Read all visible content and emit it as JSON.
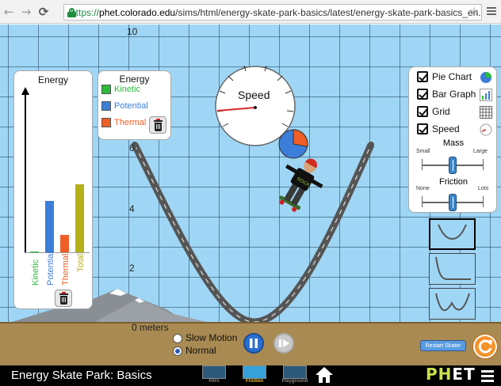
{
  "browser": {
    "url_protocol": "https://",
    "url_host": "phet.colorado.edu",
    "url_path": "/sims/html/energy-skate-park-basics/latest/energy-skate-park-basics_en.htm"
  },
  "grid": {
    "y_labels": [
      "10",
      "6",
      "4",
      "2",
      "0 meters"
    ]
  },
  "energy_bar_graph": {
    "title": "Energy",
    "bars": [
      {
        "label": "Kinetic",
        "value": 0.0,
        "color": "#2bbb3b"
      },
      {
        "label": "Potential",
        "value": 0.9,
        "color": "#3b7dd8"
      },
      {
        "label": "Thermal",
        "value": 0.3,
        "color": "#ef5e26"
      },
      {
        "label": "Total",
        "value": 1.2,
        "color": "#b4b01a"
      }
    ]
  },
  "pie_legend": {
    "title": "Energy",
    "items": [
      {
        "label": "Kinetic",
        "color": "#2bbb3b"
      },
      {
        "label": "Potential",
        "color": "#3b7dd8"
      },
      {
        "label": "Thermal",
        "color": "#ef5e26"
      }
    ]
  },
  "speedometer": {
    "label": "Speed"
  },
  "pie_chart": {
    "potential": 0.72,
    "thermal": 0.28
  },
  "controls": {
    "checkboxes": [
      {
        "label": "Pie Chart",
        "checked": true,
        "icon": "pie-chart-icon"
      },
      {
        "label": "Bar Graph",
        "checked": true,
        "icon": "bar-graph-icon"
      },
      {
        "label": "Grid",
        "checked": true,
        "icon": "grid-icon"
      },
      {
        "label": "Speed",
        "checked": true,
        "icon": "speedometer-icon"
      }
    ],
    "mass": {
      "label": "Mass",
      "min_label": "Small",
      "max_label": "Large",
      "value": 0.5
    },
    "friction": {
      "label": "Friction",
      "min_label": "None",
      "max_label": "Lots",
      "value": 0.5
    }
  },
  "playback": {
    "slow_label": "Slow Motion",
    "normal_label": "Normal",
    "selected": "Normal"
  },
  "restart_label": "Restart Skater",
  "navbar": {
    "title": "Energy Skate Park: Basics",
    "screens": [
      "Intro",
      "Friction",
      "Playground"
    ],
    "active_screen": "Friction",
    "logo_ph": "PH",
    "logo_et": "ET"
  }
}
